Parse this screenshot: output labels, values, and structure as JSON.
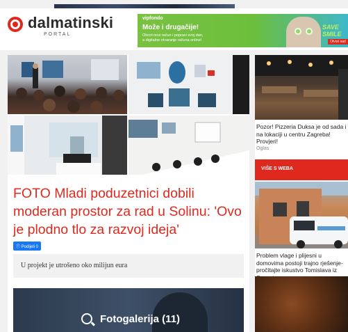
{
  "header": {
    "logo_text": "dalmatinski",
    "logo_sub": "PORTAL"
  },
  "ad": {
    "brand": "vipfondo",
    "headline": "Može i drugačije!",
    "line1": "Otvori novi račun i popravi svoj dan,",
    "line2": "a digitalne otvaranje računa online!",
    "slogan_1": "SAVE",
    "slogan_2": "SMILE",
    "cta": "Otvori sad",
    "colors": {
      "left": "#7ac142",
      "right": "#3fb7c9"
    }
  },
  "article": {
    "title": "FOTO Mladi poduzetnici dobili moderan prostor za rad u Solinu: 'Ovo je plodno tlo za razvoj ideja'",
    "share_label": "Podijeli 0",
    "lead": "U projekt je utrošeno oko milijun eura",
    "gallery_label": "Fotogalerija (11)"
  },
  "sidebar": {
    "sponsored_title": "Pozor! Pizzeria Duksa je od sada i na lokaciji u centru Zagreba! Provjeri!",
    "sponsored_tag": "Oglas",
    "section_label": "VIŠE S WEBA",
    "story_title": "Problem vlage i plijesni u domovima postoji trajno rješenje- pročitajte iskustvo Tomislava iz Sesveta"
  },
  "colors": {
    "accent": "#e0291e",
    "facebook": "#1877f2"
  }
}
